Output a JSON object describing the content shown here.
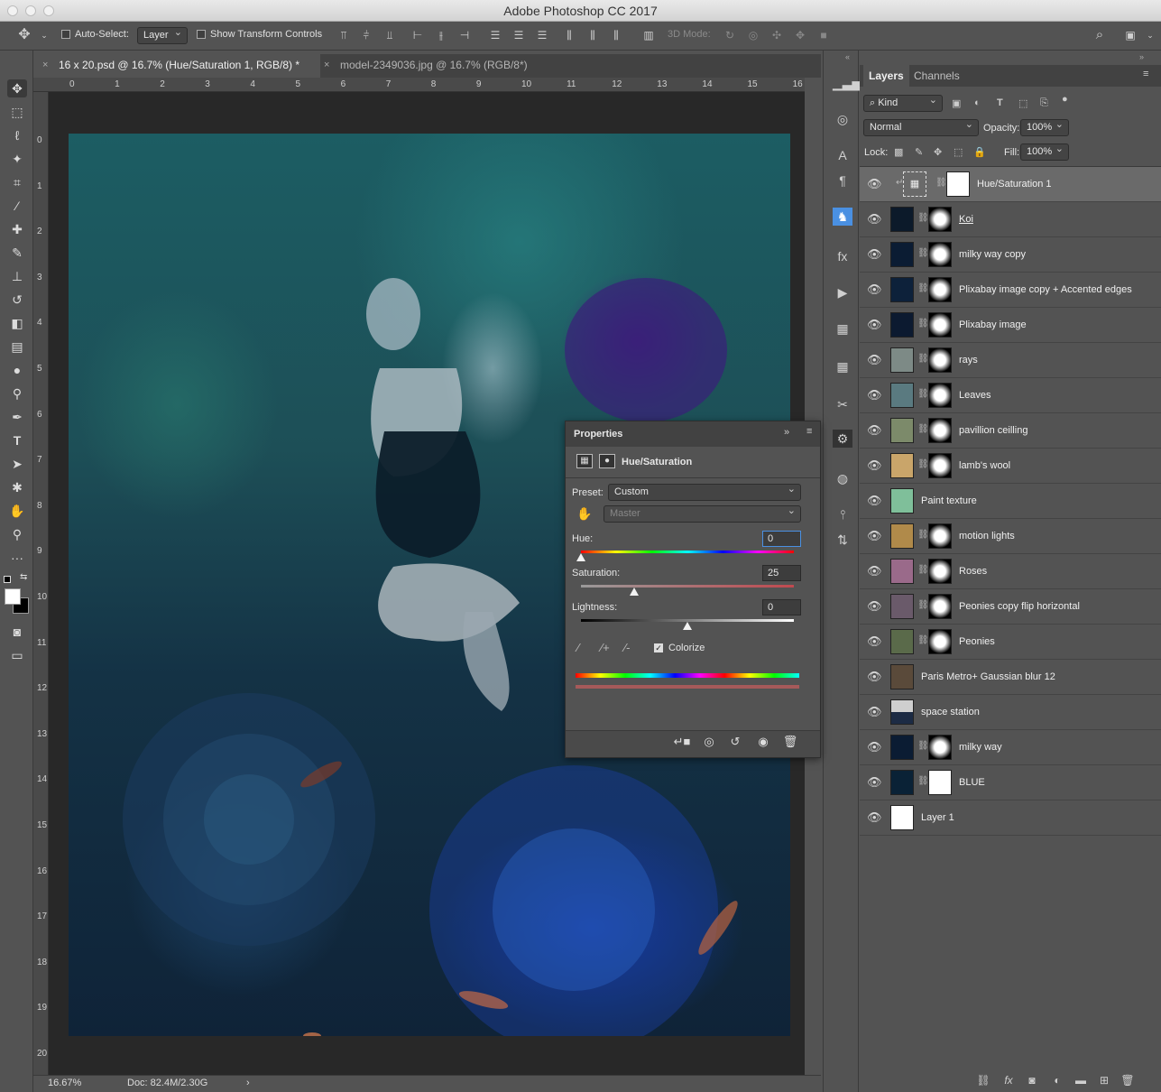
{
  "app": {
    "title": "Adobe Photoshop CC 2017"
  },
  "options": {
    "auto_select_label": "Auto-Select:",
    "auto_select_value": "Layer",
    "show_transform_label": "Show Transform Controls",
    "mode_3d_label": "3D Mode:"
  },
  "tabs": [
    {
      "label": "16 x 20.psd @ 16.7% (Hue/Saturation 1, RGB/8) *",
      "close": "×"
    },
    {
      "label": "model-2349036.jpg @ 16.7% (RGB/8*)",
      "close": "×"
    }
  ],
  "rulers": {
    "top": [
      "0",
      "1",
      "2",
      "3",
      "4",
      "5",
      "6",
      "7",
      "8",
      "9",
      "10",
      "11",
      "12",
      "13",
      "14",
      "15",
      "16"
    ],
    "left": [
      "0",
      "1",
      "2",
      "3",
      "4",
      "5",
      "6",
      "7",
      "8",
      "9",
      "10",
      "11",
      "12",
      "13",
      "14",
      "15",
      "16",
      "17",
      "18",
      "19",
      "20"
    ]
  },
  "status": {
    "zoom": "16.67%",
    "doc": "Doc: 82.4M/2.30G",
    "arrow": "›"
  },
  "properties": {
    "title": "Properties",
    "subtitle": "Hue/Saturation",
    "preset_label": "Preset:",
    "preset_value": "Custom",
    "channel_value": "Master",
    "hue_label": "Hue:",
    "hue_value": "0",
    "saturation_label": "Saturation:",
    "saturation_value": "25",
    "lightness_label": "Lightness:",
    "lightness_value": "0",
    "colorize_label": "Colorize",
    "colorize_checked": true,
    "hue_level": 0.0,
    "saturation_level": 0.25,
    "lightness_level": 0.5
  },
  "layers_panel": {
    "tabs": [
      "Layers",
      "Channels"
    ],
    "filter_kind": "Kind",
    "blend_mode": "Normal",
    "opacity_label": "Opacity:",
    "opacity_value": "100%",
    "lock_label": "Lock:",
    "fill_label": "Fill:",
    "fill_value": "100%",
    "layers": [
      {
        "name": "Hue/Saturation 1",
        "selected": true,
        "kind": "adjustment"
      },
      {
        "name": "Koi",
        "kind": "masked"
      },
      {
        "name": "milky way copy",
        "kind": "masked"
      },
      {
        "name": "Plixabay image copy + Accented edges",
        "kind": "masked"
      },
      {
        "name": "Plixabay image",
        "kind": "masked"
      },
      {
        "name": "rays",
        "kind": "masked"
      },
      {
        "name": "Leaves",
        "kind": "masked"
      },
      {
        "name": "pavillion ceilling",
        "kind": "masked"
      },
      {
        "name": "lamb's wool",
        "kind": "masked"
      },
      {
        "name": "Paint texture",
        "kind": "plain"
      },
      {
        "name": "motion lights",
        "kind": "masked"
      },
      {
        "name": "Roses",
        "kind": "masked"
      },
      {
        "name": "Peonies copy flip horizontal",
        "kind": "masked"
      },
      {
        "name": "Peonies",
        "kind": "masked"
      },
      {
        "name": "Paris Metro+ Gaussian blur 12",
        "kind": "plain"
      },
      {
        "name": "space station",
        "kind": "plain"
      },
      {
        "name": "milky way",
        "kind": "masked"
      },
      {
        "name": "BLUE",
        "kind": "masked"
      },
      {
        "name": "Layer 1",
        "kind": "plain"
      }
    ]
  },
  "colors": {
    "panel": "#535353",
    "dark": "#424242",
    "selected_row": "#6a6a6a",
    "accent": "#4a90e2"
  }
}
